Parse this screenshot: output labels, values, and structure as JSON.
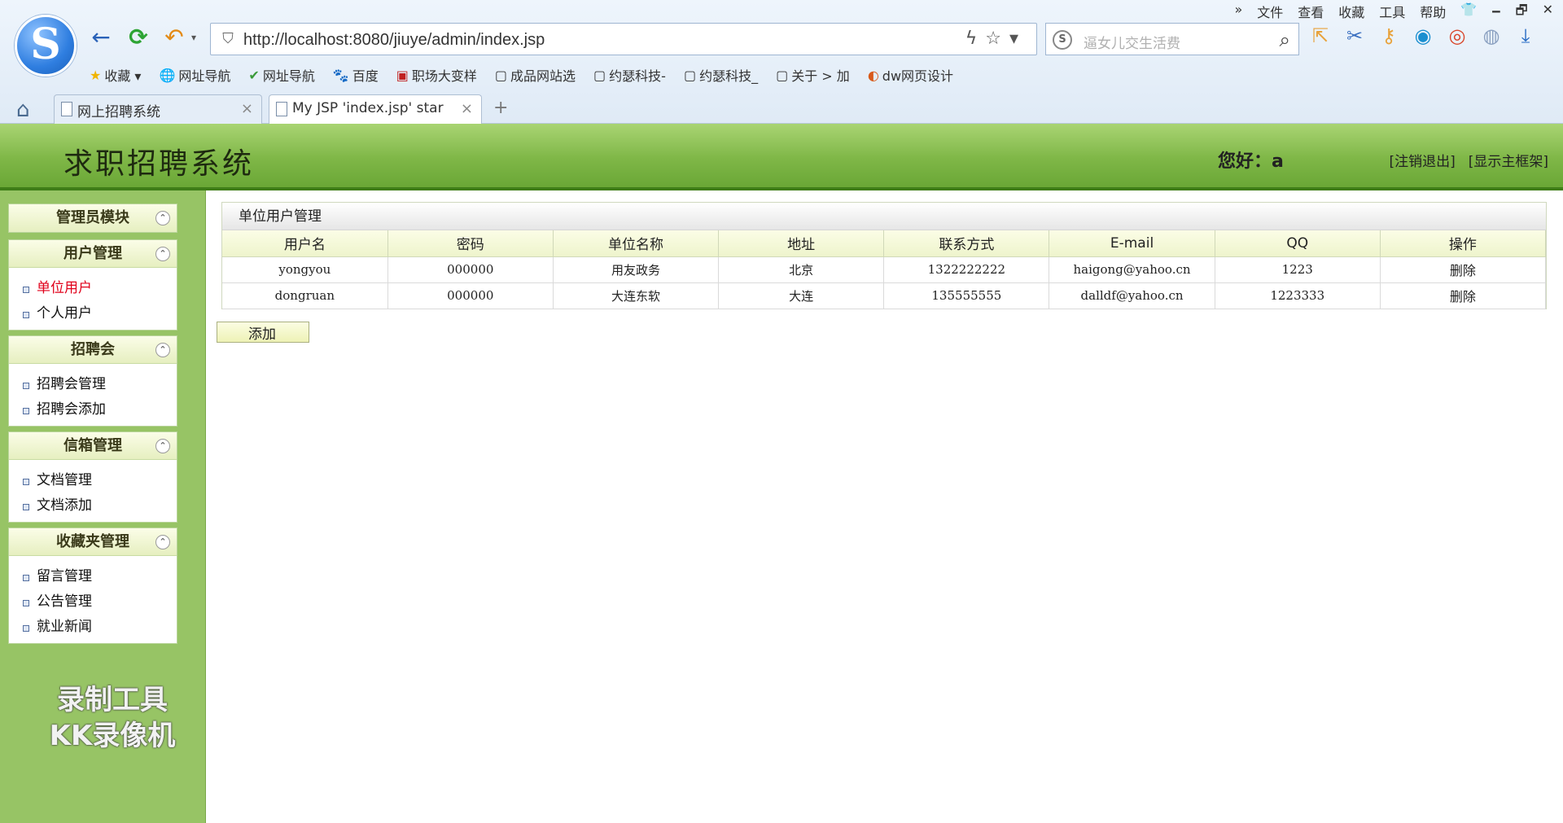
{
  "browser": {
    "logo_letter": "S",
    "url": "http://localhost:8080/jiuye/admin/index.jsp",
    "search_placeholder": "逼女儿交生活费",
    "menu": [
      "»",
      "文件",
      "查看",
      "收藏",
      "工具",
      "帮助"
    ],
    "window_controls": [
      "🗕",
      "🗗",
      "✕"
    ],
    "bookmarks": [
      {
        "icon": "★",
        "label": "收藏 ▾"
      },
      {
        "icon": "🌐",
        "label": "网址导航"
      },
      {
        "icon": "✔",
        "label": "网址导航"
      },
      {
        "icon": "🐾",
        "label": "百度"
      },
      {
        "icon": "▣",
        "label": "职场大变样"
      },
      {
        "icon": "▢",
        "label": "成品网站选"
      },
      {
        "icon": "▢",
        "label": "约瑟科技-"
      },
      {
        "icon": "▢",
        "label": "约瑟科技_"
      },
      {
        "icon": "▢",
        "label": "关于 > 加"
      },
      {
        "icon": "◐",
        "label": "dw网页设计"
      }
    ],
    "tabs": [
      {
        "label": "网上招聘系统"
      },
      {
        "label": "My JSP 'index.jsp' star"
      }
    ],
    "new_tab": "+"
  },
  "header": {
    "title": "求职招聘系统",
    "greeting": "您好：a",
    "logout": "[注销退出]",
    "show_frame": "[显示主框架]"
  },
  "sidebar": {
    "sections": [
      {
        "title": "管理员模块",
        "items": []
      },
      {
        "title": "用户管理",
        "items": [
          "单位用户",
          "个人用户"
        ]
      },
      {
        "title": "招聘会",
        "items": [
          "招聘会管理",
          "招聘会添加"
        ]
      },
      {
        "title": "信箱管理",
        "items": [
          "文档管理",
          "文档添加"
        ]
      },
      {
        "title": "收藏夹管理",
        "items": [
          "留言管理",
          "公告管理",
          "就业新闻"
        ]
      }
    ],
    "watermark_line1": "录制工具",
    "watermark_line2": "KK录像机"
  },
  "main": {
    "panel_title": "单位用户管理",
    "columns": [
      "用户名",
      "密码",
      "单位名称",
      "地址",
      "联系方式",
      "E-mail",
      "QQ",
      "操作"
    ],
    "rows": [
      [
        "yongyou",
        "000000",
        "用友政务",
        "北京",
        "1322222222",
        "haigong@yahoo.cn",
        "1223",
        "删除"
      ],
      [
        "dongruan",
        "000000",
        "大连东软",
        "大连",
        "135555555",
        "dalldf@yahoo.cn",
        "1223333",
        "删除"
      ]
    ],
    "add_label": "添加"
  },
  "colors": {
    "header_green": "#7fb747",
    "sidebar_green": "#97c465",
    "active_red": "#e0001a"
  }
}
